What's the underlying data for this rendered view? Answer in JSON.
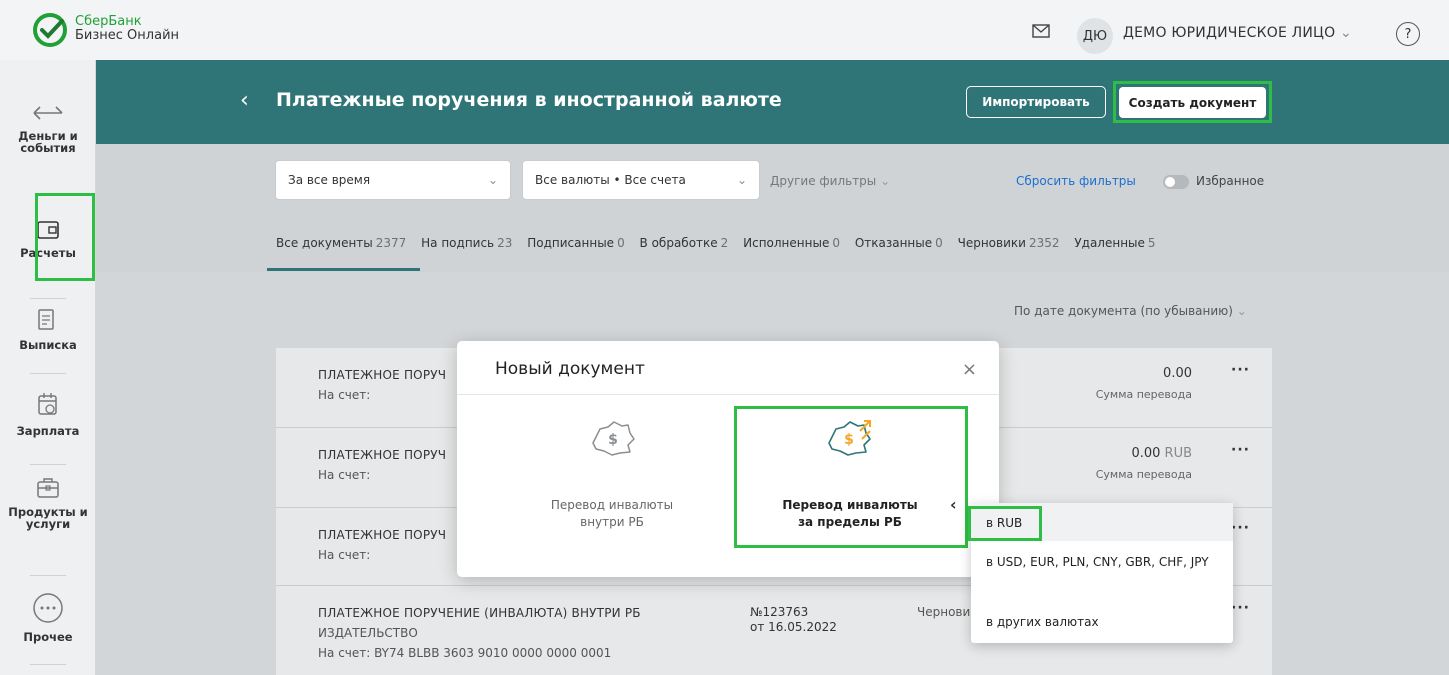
{
  "topbar": {
    "brand_line1": "СберБанк",
    "brand_line2": "Бизнес Онлайн",
    "avatar_initials": "ДЮ",
    "org_name": "ДЕМО ЮРИДИЧЕСКОЕ ЛИЦО",
    "org_chevron": "⌄",
    "help": "?"
  },
  "sidebar": {
    "items": [
      {
        "label_1": "Деньги и",
        "label_2": "события"
      },
      {
        "label_1": "Расчеты",
        "label_2": ""
      },
      {
        "label_1": "Выписка",
        "label_2": ""
      },
      {
        "label_1": "Зарплата",
        "label_2": ""
      },
      {
        "label_1": "Продукты и",
        "label_2": "услуги"
      },
      {
        "label_1": "Прочее",
        "label_2": ""
      }
    ]
  },
  "header": {
    "back": "‹",
    "title": "Платежные поручения в иностранной валюте",
    "import_label": "Импортировать",
    "create_label": "Создать документ"
  },
  "filters": {
    "period": "За все время",
    "accounts": "Все валюты • Все счета",
    "other": "Другие фильтры",
    "reset": "Сбросить фильтры",
    "favorites": "Избранное"
  },
  "tabs": [
    {
      "label": "Все документы",
      "count": "2377"
    },
    {
      "label": "На подпись",
      "count": "23"
    },
    {
      "label": "Подписанные",
      "count": "0"
    },
    {
      "label": "В обработке",
      "count": "2"
    },
    {
      "label": "Исполненные",
      "count": "0"
    },
    {
      "label": "Отказанные",
      "count": "0"
    },
    {
      "label": "Черновики",
      "count": "2352"
    },
    {
      "label": "Удаленные",
      "count": "5"
    }
  ],
  "sort": {
    "label": "По дате документа (по убыванию)"
  },
  "documents": [
    {
      "title": "ПЛАТЕЖНОЕ ПОРУЧ",
      "sub": "На счет:",
      "amount": "0.00",
      "currency": "",
      "amount_label": "Сумма перевода"
    },
    {
      "title": "ПЛАТЕЖНОЕ ПОРУЧ",
      "sub": "На счет:",
      "amount": "0.00",
      "currency": "RUB",
      "amount_label": "Сумма перевода"
    },
    {
      "title": "ПЛАТЕЖНОЕ ПОРУЧ",
      "sub": "На счет:",
      "amount": "",
      "currency": "",
      "amount_label": ""
    },
    {
      "title": "ПЛАТЕЖНОЕ ПОРУЧЕНИЕ (ИНВАЛЮТА) ВНУТРИ РБ",
      "sub2": "ИЗДАТЕЛЬСТВО",
      "sub": "На счет: BY74 BLBB 3603 9010 0000 0000 0001",
      "number": "№123763",
      "date": "от 16.05.2022",
      "status": "Чернови"
    }
  ],
  "modal": {
    "title": "Новый документ",
    "close": "×",
    "option1_line1": "Перевод инвалюты",
    "option1_line2": "внутри РБ",
    "option2_line1": "Перевод инвалюты",
    "option2_line2": "за пределы РБ",
    "option2_chevron": "‹"
  },
  "dropdown": {
    "items": [
      "в RUB",
      "в USD, EUR, PLN, CNY, GBR, CHF, JPY",
      "в других валютах"
    ]
  },
  "colors": {
    "brand_green": "#21a038",
    "header_teal": "#2f7577",
    "highlight": "#2ebd45",
    "link_blue": "#1a6fd0",
    "icon_orange": "#f5a623"
  }
}
